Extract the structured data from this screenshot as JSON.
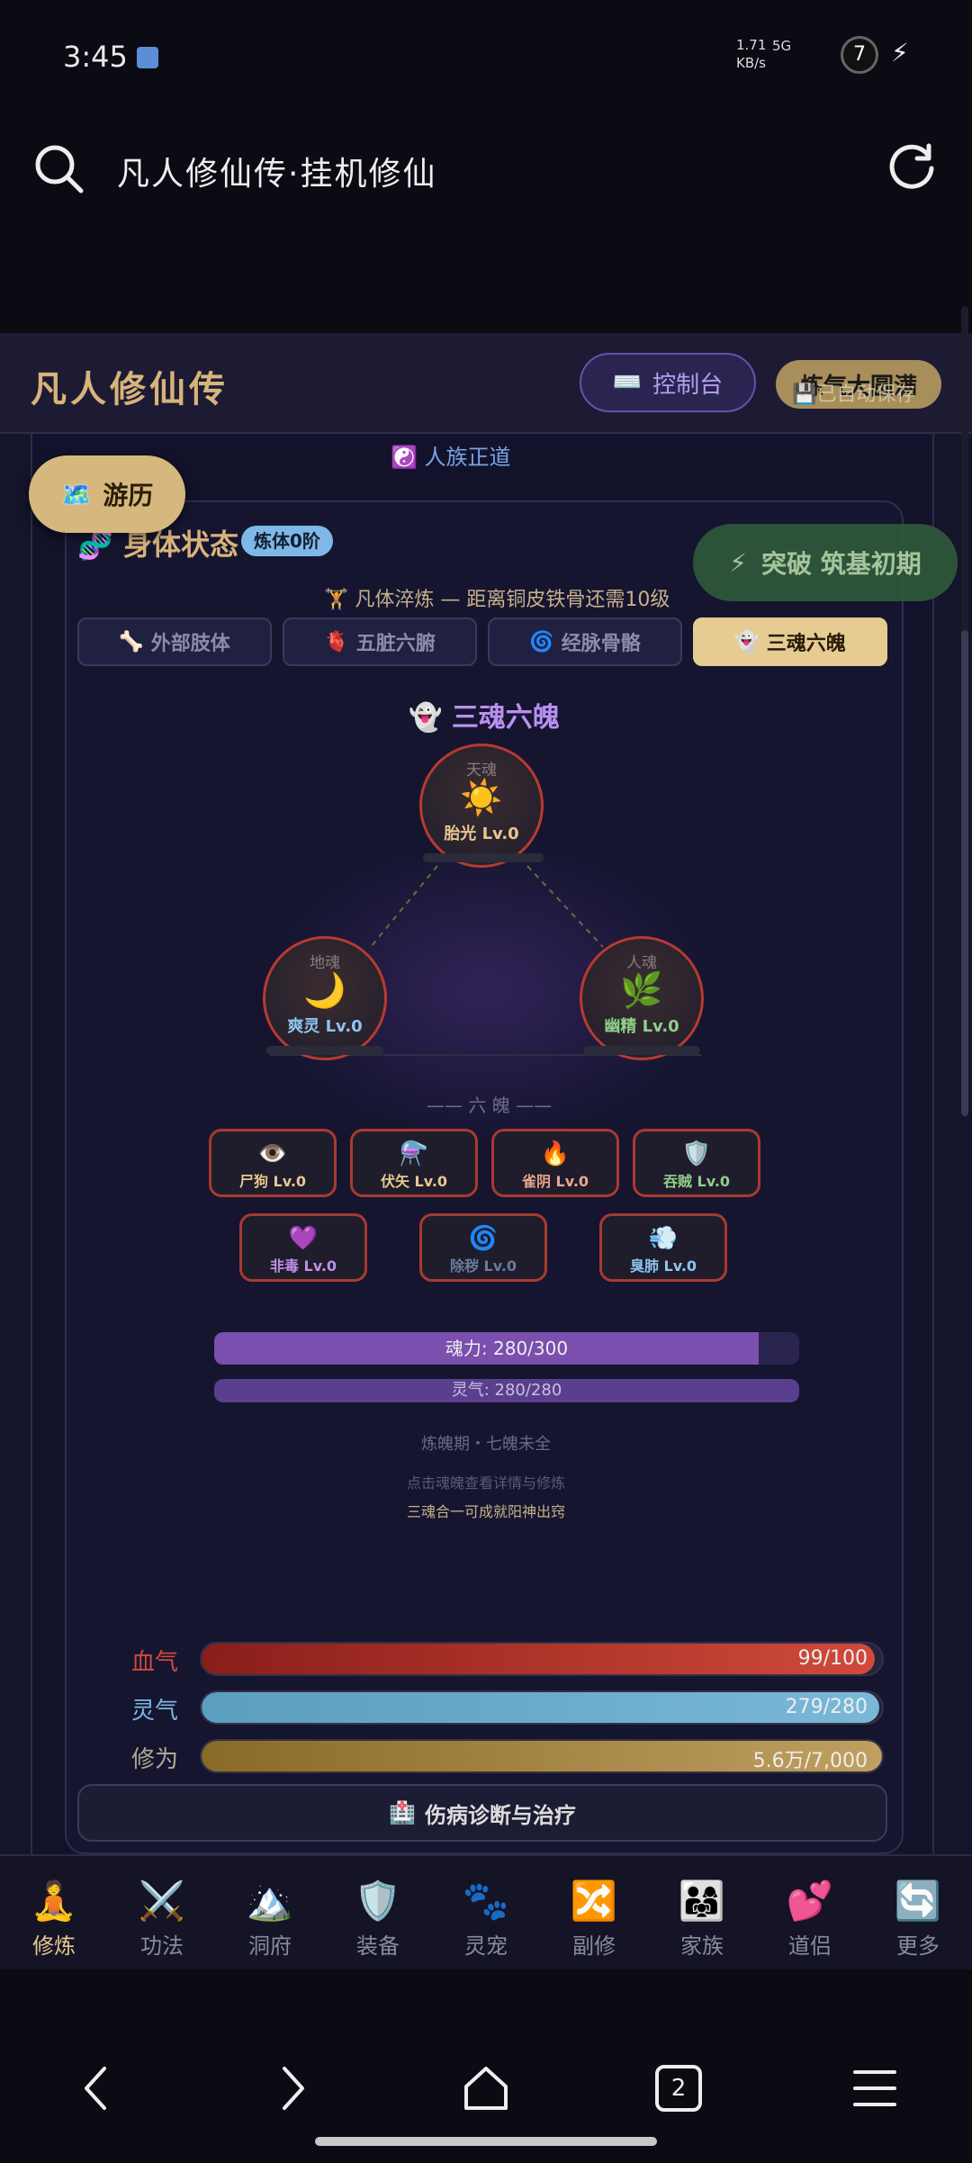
{
  "status_bar": {
    "time": "3:45",
    "net_speed_value": "1.71",
    "net_speed_unit": "KB/s",
    "network": "5G",
    "battery": "7"
  },
  "browser": {
    "title": "凡人修仙传·挂机修仙"
  },
  "header": {
    "title": "凡人修仙传",
    "console_label": "控制台",
    "realm_label": "炼气大圆满",
    "autosave_label": "已自动保存"
  },
  "faction": "人族正道",
  "explore_label": "游历",
  "breakthrough_label": "突破 筑基初期",
  "body_status": {
    "title": "身体状态",
    "badge": "炼体0阶",
    "training_line": "凡体淬炼 — 距离铜皮铁骨还需10级"
  },
  "tabs": [
    {
      "icon": "🦴",
      "label": "外部肢体"
    },
    {
      "icon": "🫀",
      "label": "五脏六腑"
    },
    {
      "icon": "🌀",
      "label": "经脉骨骼"
    },
    {
      "icon": "👻",
      "label": "三魂六魄"
    }
  ],
  "souls_section": {
    "title": "三魂六魄",
    "three_souls": [
      {
        "tag": "天魂",
        "icon": "☀️",
        "level": "胎光 Lv.0",
        "color": "#e8c890"
      },
      {
        "tag": "地魂",
        "icon": "🌙",
        "level": "爽灵 Lv.0",
        "color": "#8ec4f0"
      },
      {
        "tag": "人魂",
        "icon": "🌿",
        "level": "幽精 Lv.0",
        "color": "#8fd08a"
      }
    ],
    "six_label": "—— 六 魄 ——",
    "six_spirits": [
      {
        "icon": "👁️",
        "level": "尸狗 Lv.0",
        "color": "#e8c890"
      },
      {
        "icon": "⚗️",
        "level": "伏矢 Lv.0",
        "color": "#e8c890"
      },
      {
        "icon": "🔥",
        "level": "雀阴 Lv.0",
        "color": "#e8a890"
      },
      {
        "icon": "🛡️",
        "level": "吞贼 Lv.0",
        "color": "#8fd08a"
      },
      {
        "icon": "💜",
        "level": "非毒 Lv.0",
        "color": "#c090e8"
      },
      {
        "icon": "🌀",
        "level": "除秽 Lv.0",
        "color": "#6a7aa0"
      },
      {
        "icon": "💨",
        "level": "臭肺 Lv.0",
        "color": "#8ec4f0"
      }
    ],
    "soul_power": {
      "label": "魂力: 280/300",
      "fraction": 0.93
    },
    "spirit_power": {
      "label": "灵气: 280/280",
      "fraction": 1.0
    },
    "stage_note": "炼魄期・七魄未全",
    "hint": "点击魂魄查看详情与修炼",
    "tip": "三魂合一可成就阳神出窍"
  },
  "stats": [
    {
      "label": "血气",
      "value": "99/100",
      "fraction": 0.99,
      "color": "#c0392b",
      "label_color": "#d04a3a"
    },
    {
      "label": "灵气",
      "value": "279/280",
      "fraction": 0.996,
      "color": "#6aaed0",
      "label_color": "#7ab8e0"
    },
    {
      "label": "修为",
      "value": "5.6万/7,000",
      "fraction": 1.0,
      "color": "#a88a40",
      "label_color": "#b0a890"
    }
  ],
  "diagnosis_label": "伤病诊断与治疗",
  "bottom_nav": [
    {
      "icon": "🧘",
      "label": "修炼",
      "active": true
    },
    {
      "icon": "⚔️",
      "label": "功法",
      "active": false
    },
    {
      "icon": "🏔️",
      "label": "洞府",
      "active": false
    },
    {
      "icon": "🛡️",
      "label": "装备",
      "active": false
    },
    {
      "icon": "🐾",
      "label": "灵宠",
      "active": false
    },
    {
      "icon": "🔀",
      "label": "副修",
      "active": false
    },
    {
      "icon": "👨‍👩‍👧",
      "label": "家族",
      "active": false
    },
    {
      "icon": "💕",
      "label": "道侣",
      "active": false
    },
    {
      "icon": "🔄",
      "label": "更多",
      "active": false
    }
  ],
  "system_nav": {
    "tab_count": "2"
  }
}
